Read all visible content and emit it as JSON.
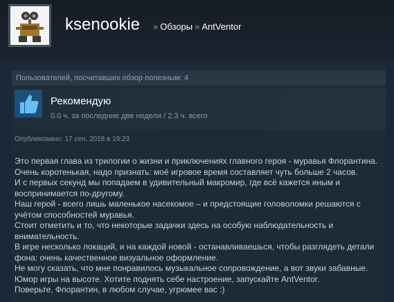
{
  "header": {
    "username": "ksenookie",
    "breadcrumbs": [
      {
        "label": "Обзоры"
      },
      {
        "label": "AntVentor"
      }
    ]
  },
  "review": {
    "helpful_text": "Пользователей, посчитавших обзор полезным: 4",
    "recommend_label": "Рекомендую",
    "hours_text": "0.0 ч. за последние две недели / 2.3 ч. всего",
    "posted_text": "Опубликовано: 17 сен. 2018 в 19:23",
    "lines": [
      "Это первая глава из трилогии о жизни и приключениях главного героя - муравья Флорантина.",
      "Очень коротенькая, надо признать: моё игровое время составляет чуть больше 2 часов.",
      "И с первых секунд мы попадаем в удивительный макромир, где всё кажется иным и воспринимается по-другому.",
      "Наш герой - всего лишь маленькое насекомое – и предстоящие головоломки решаются с учётом способностей муравья.",
      "Стоит отметить и то, что некоторые задачки здесь на особую наблюдательность и внимательность.",
      "В игре несколько локаций, и на каждой новой - останавливаешься, чтобы разглядеть детали фона: очень качественное визуальное оформление.",
      "Не могу сказать, что мне понравилось музыкальное сопровождение, а вот звуки забавные.",
      "Юмор игры на высоте. Хотите поднять себе настроение, запускайте AntVentor.",
      "Поверьте, Флорантин, в любом случае, угрюмее вас :)"
    ]
  },
  "icons": {
    "avatar": "robot-avatar",
    "recommend": "thumbs-up-icon"
  },
  "colors": {
    "background": "#1b2838",
    "thumb_blue": "#66c0f4"
  }
}
